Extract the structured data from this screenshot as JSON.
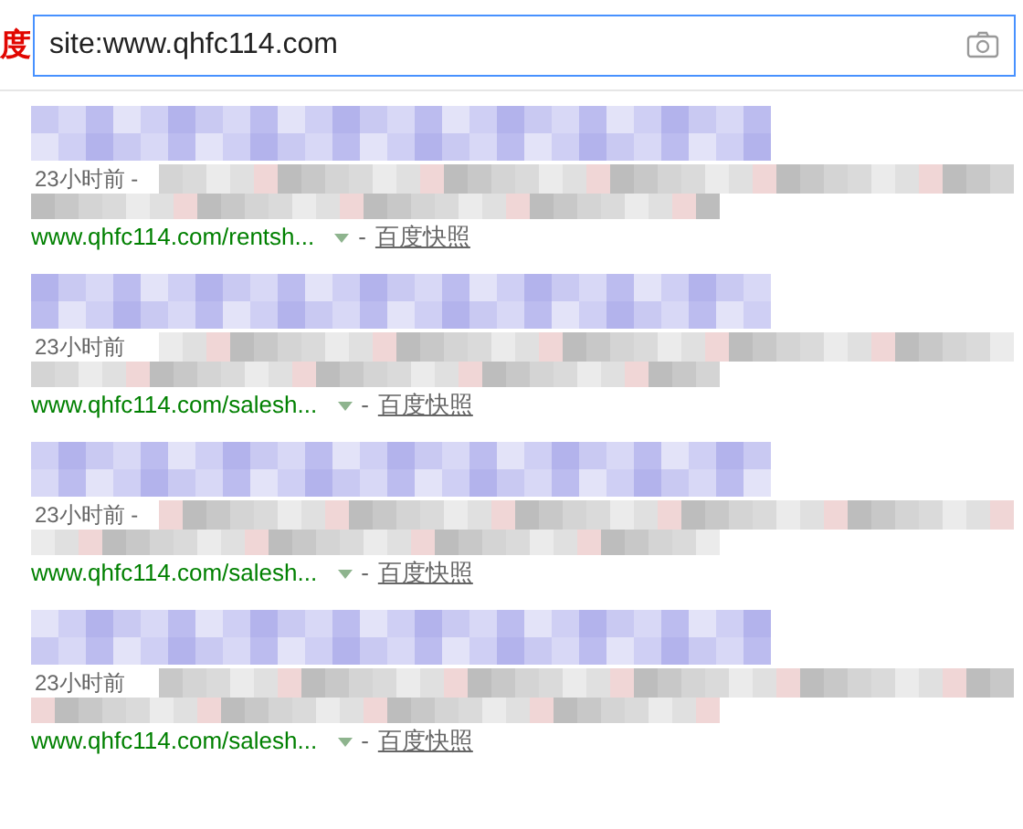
{
  "logo_text": "度",
  "search": {
    "value": "site:www.qhfc114.com"
  },
  "results": [
    {
      "time": "23小时前 -",
      "url": "www.qhfc114.com/rentsh...",
      "separator": "-",
      "snapshot": "百度快照"
    },
    {
      "time": "23小时前",
      "url": "www.qhfc114.com/salesh...",
      "separator": "-",
      "snapshot": "百度快照"
    },
    {
      "time": "23小时前 -",
      "url": "www.qhfc114.com/salesh...",
      "separator": "-",
      "snapshot": "百度快照"
    },
    {
      "time": "23小时前",
      "url": "www.qhfc114.com/salesh...",
      "separator": "-",
      "snapshot": "百度快照"
    }
  ]
}
